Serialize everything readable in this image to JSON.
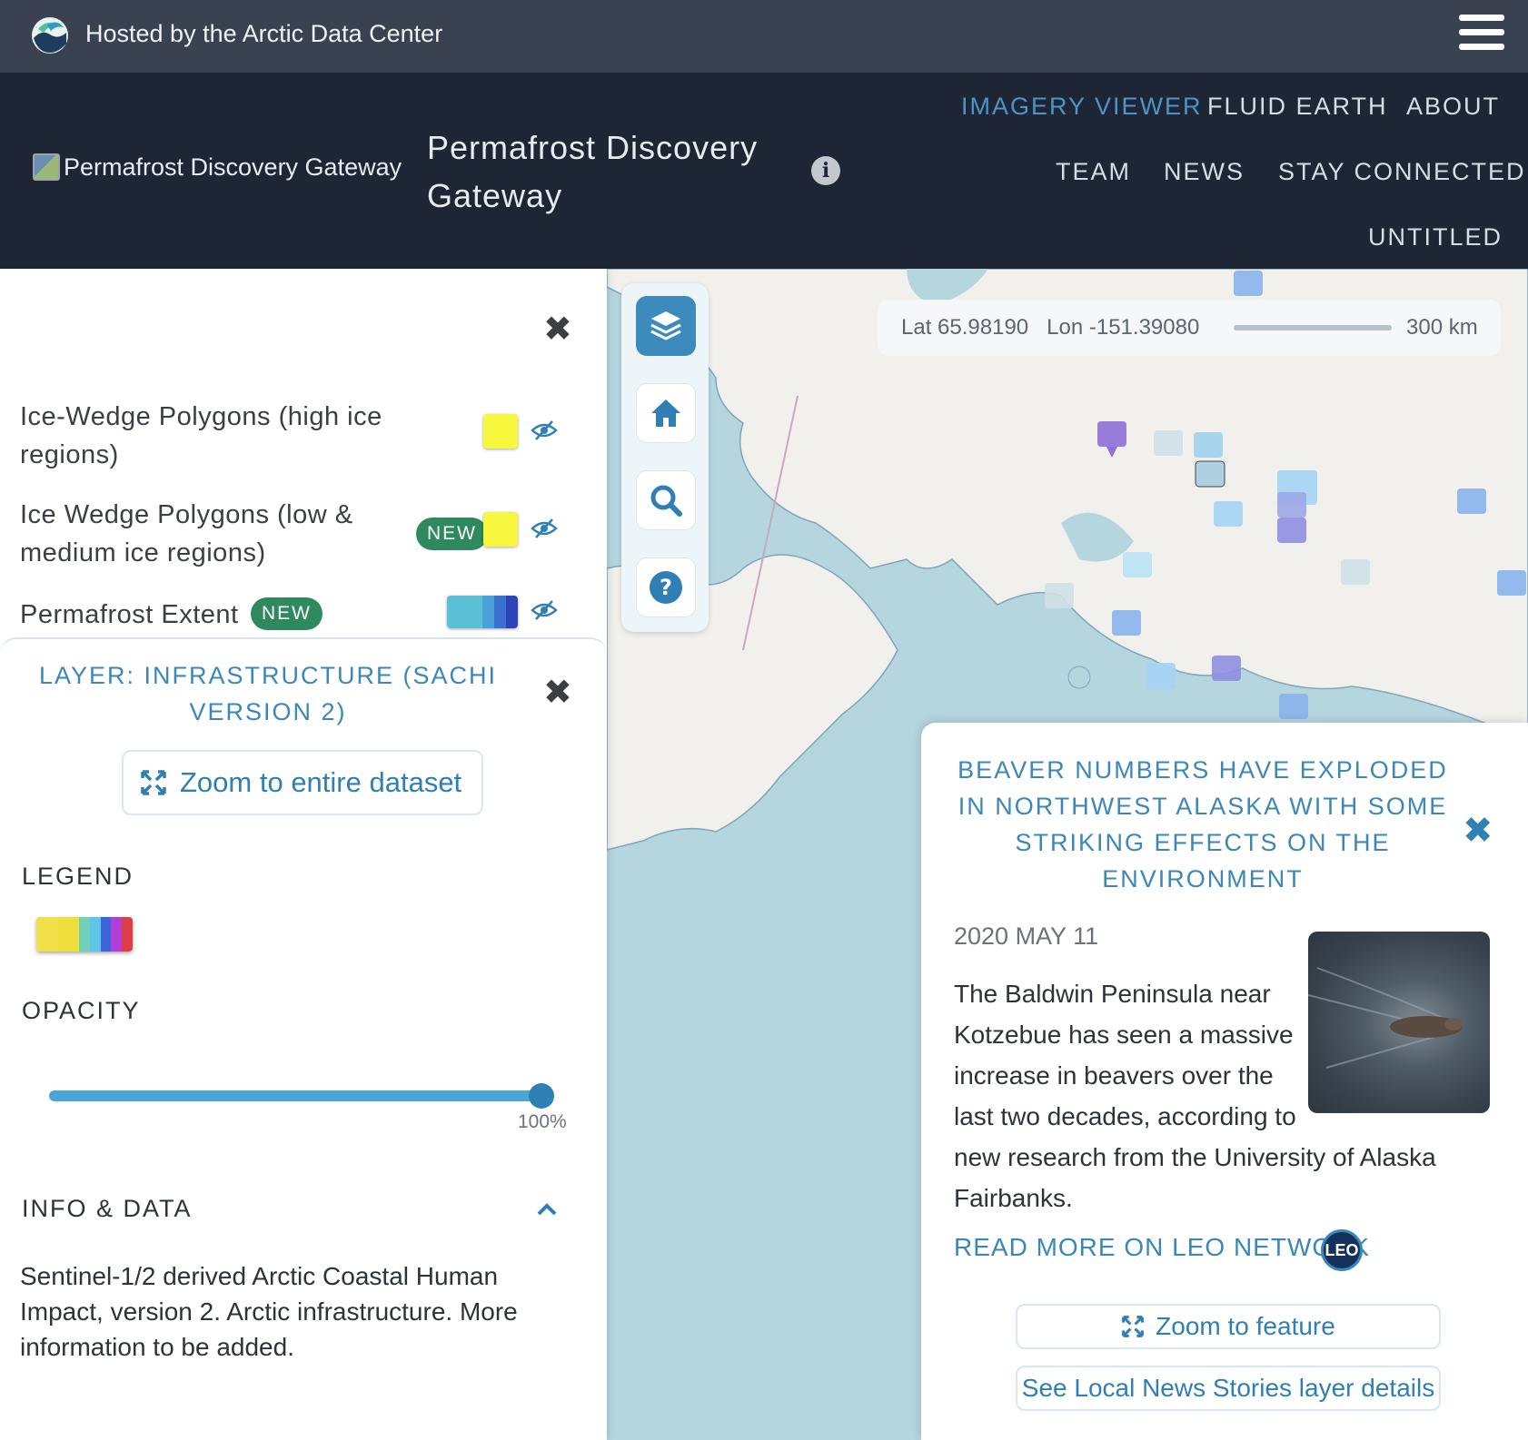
{
  "topbar": {
    "hosted_text": "Hosted by the Arctic Data Center",
    "logo_icon": "arctic-data-center-logo-icon",
    "menu_icon": "hamburger-menu-icon"
  },
  "header": {
    "brand_image_alt": "Permafrost Discovery Gateway",
    "title": "Permafrost Discovery Gateway",
    "info_icon": "info-icon",
    "nav": {
      "imagery_viewer": "IMAGERY VIEWER",
      "fluid_earth": "FLUID EARTH",
      "about": "ABOUT",
      "team": "TEAM",
      "news": "NEWS",
      "stay_connected": "STAY CONNECTED",
      "untitled": "UNTITLED"
    },
    "active_nav": "IMAGERY VIEWER",
    "colors": {
      "active": "#4e94c8",
      "background": "#1e2636"
    }
  },
  "layers": {
    "items": [
      {
        "label": "Ice-Wedge Polygons (high ice regions)",
        "badge": "",
        "swatch": "#f7f73d"
      },
      {
        "label": "Ice Wedge Polygons (low & medium ice regions)",
        "badge": "NEW",
        "swatch": "#f7f73d"
      },
      {
        "label": "Permafrost Extent",
        "badge": "NEW",
        "swatch": "multi-blue"
      }
    ]
  },
  "layer_detail": {
    "title": "LAYER: INFRASTRUCTURE (SACHI VERSION 2)",
    "zoom_button": "Zoom to entire dataset",
    "legend_heading": "LEGEND",
    "legend_colors": [
      "#f2e04a",
      "#eede3a",
      "#72d0b8",
      "#5ec4e8",
      "#3e63d8",
      "#b13ed6",
      "#e03d4a"
    ],
    "opacity_heading": "OPACITY",
    "opacity_value": "100%",
    "opacity_fraction": 1.0,
    "info_heading": "INFO & DATA",
    "info_text": "Sentinel-1/2 derived Arctic Coastal Human Impact, version 2. Arctic infrastructure. More information to be added."
  },
  "map": {
    "coords_lat": "Lat 65.98190",
    "coords_lon": "Lon -151.39080",
    "scale": "300 km",
    "tools": [
      "layers-icon",
      "home-icon",
      "search-icon",
      "help-icon"
    ]
  },
  "story": {
    "title": "BEAVER NUMBERS HAVE EXPLODED IN NORTHWEST ALASKA WITH SOME STRIKING EFFECTS ON THE ENVIRONMENT",
    "date": "2020 MAY 11",
    "text_lines": [
      "The Baldwin Peninsula near",
      "Kotzebue has seen a massive",
      "increase in beavers over the",
      "last two decades, according to",
      "new research from the University of Alaska",
      "Fairbanks."
    ],
    "read_more": "READ MORE ON LEO NETWORK",
    "leo_badge": "LEO",
    "zoom_button": "Zoom to feature",
    "details_button": "See Local News Stories layer details"
  }
}
